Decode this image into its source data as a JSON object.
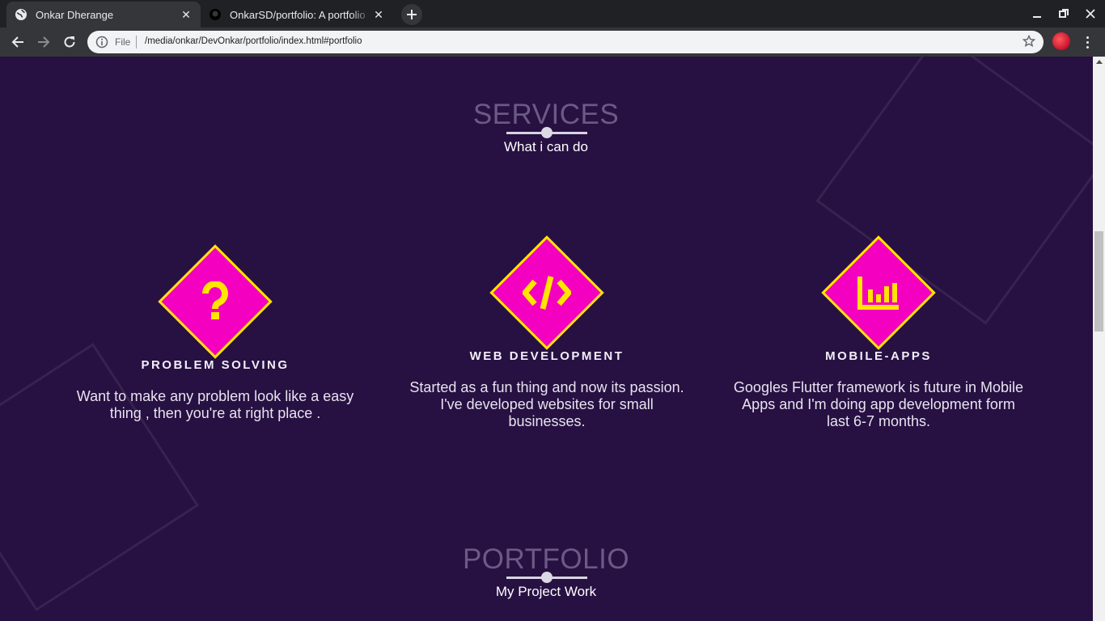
{
  "browser": {
    "tabs": [
      {
        "title": "Onkar Dherange",
        "active": true,
        "favicon": "globe-icon"
      },
      {
        "title": "OnkarSD/portfolio: A portfolio",
        "active": false,
        "favicon": "github-icon"
      }
    ],
    "omnibox": {
      "scheme_label": "File",
      "url": "/media/onkar/DevOnkar/portfolio/index.html#portfolio"
    }
  },
  "page": {
    "services": {
      "title": "SERVICES",
      "subtitle": "What i can do",
      "items": [
        {
          "title": "PROBLEM SOLVING",
          "description": "Want to make any problem look like a easy thing , then you're at right place .",
          "icon": "question-icon"
        },
        {
          "title": "WEB DEVELOPMENT",
          "description": "Started as a fun thing and now its passion. I've developed websites for small businesses.",
          "icon": "code-icon"
        },
        {
          "title": "MOBILE-APPS",
          "description": "Googles Flutter framework is future in Mobile Apps and I'm doing app development form last 6-7 months.",
          "icon": "bar-chart-icon"
        }
      ]
    },
    "portfolio": {
      "title": "PORTFOLIO",
      "subtitle": "My Project Work"
    }
  },
  "colors": {
    "page_background": "#271042",
    "diamond_fill": "#f400c0",
    "diamond_border": "#ffe500",
    "icon_color": "#ffe500",
    "section_title": "#6b5a85"
  }
}
